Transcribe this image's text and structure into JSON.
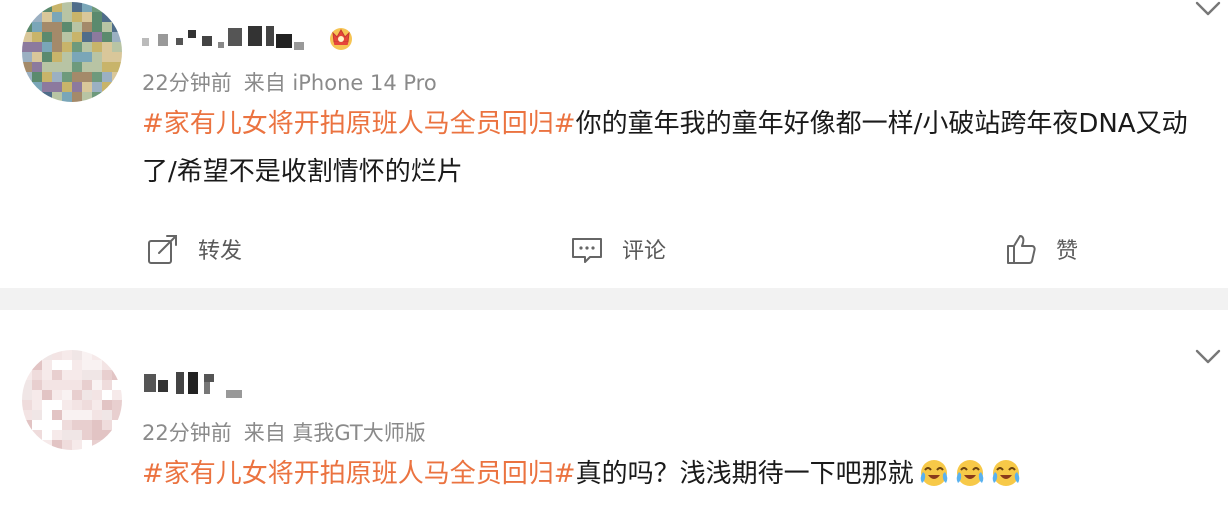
{
  "posts": [
    {
      "time": "22分钟前",
      "source": "来自 iPhone 14 Pro",
      "hashtag": "#家有儿女将开拍原班人马全员回归#",
      "text": "你的童年我的童年好像都一样/小破站跨年夜DNA又动了/希望不是收割情怀的烂片",
      "icons": [
        "crown-badge-icon",
        "chevron-down-icon"
      ],
      "colors": {
        "hashtag": "#eb7340",
        "meta": "#8a8a8a"
      }
    },
    {
      "time": "22分钟前",
      "source": "来自 真我GT大师版",
      "hashtag": "#家有儿女将开拍原班人马全员回归#",
      "text": "真的吗？浅浅期待一下吧那就",
      "emojis": [
        "crying-laugh-emoji",
        "crying-laugh-emoji",
        "crying-laugh-emoji"
      ],
      "icons": [
        "chevron-down-icon"
      ]
    }
  ],
  "actions": {
    "repost_label": "转发",
    "comment_label": "评论",
    "like_label": "赞"
  }
}
